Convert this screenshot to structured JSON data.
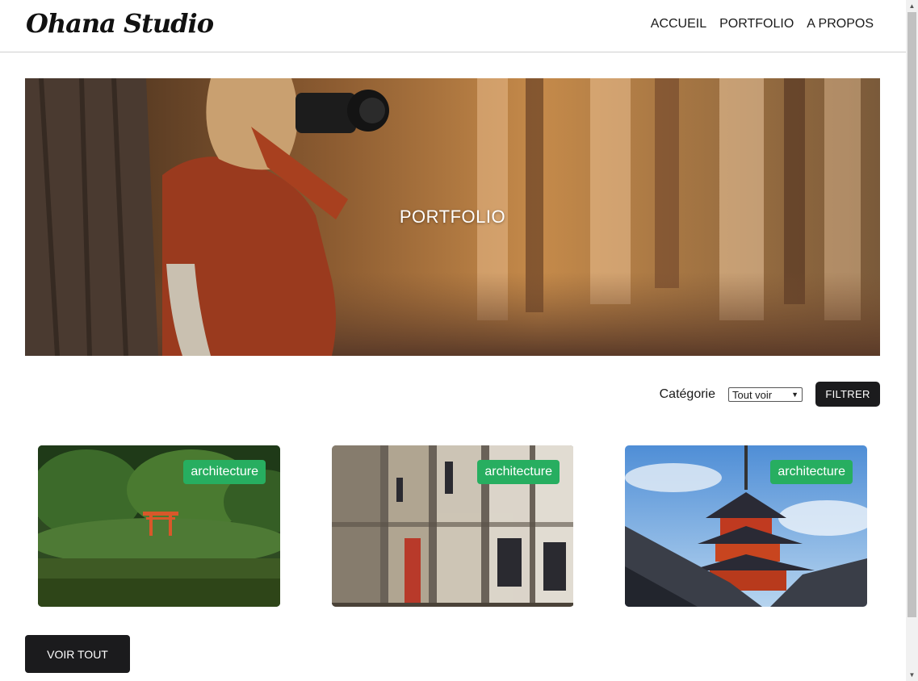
{
  "header": {
    "logo": "Ohana Studio",
    "nav": [
      "ACCUEIL",
      "PORTFOLIO",
      "A PROPOS"
    ]
  },
  "hero": {
    "title": "PORTFOLIO"
  },
  "filter": {
    "label": "Catégorie",
    "selected": "Tout voir",
    "button": "FILTRER"
  },
  "cards": [
    {
      "category": "architecture",
      "image": "torii-gate-garden"
    },
    {
      "category": "architecture",
      "image": "sake-barrels"
    },
    {
      "category": "architecture",
      "image": "pagoda"
    }
  ],
  "voir_tout": "VOIR TOUT",
  "colors": {
    "badge": "#27ae60",
    "button": "#1b1b1d"
  }
}
